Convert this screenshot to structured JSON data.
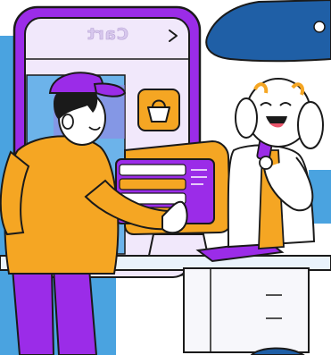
{
  "phone": {
    "title": "Cart",
    "title_mirrored": true,
    "nav_icon": "chevron-right-icon",
    "app_icon": "shopping-basket-icon"
  },
  "colors": {
    "purple": "#9b2ce8",
    "orange": "#f5a623",
    "blue_left": "#4aa3e0",
    "navy": "#1f5fa6",
    "outline": "#1a1a1a",
    "screen_bg": "#f1e8fb"
  }
}
